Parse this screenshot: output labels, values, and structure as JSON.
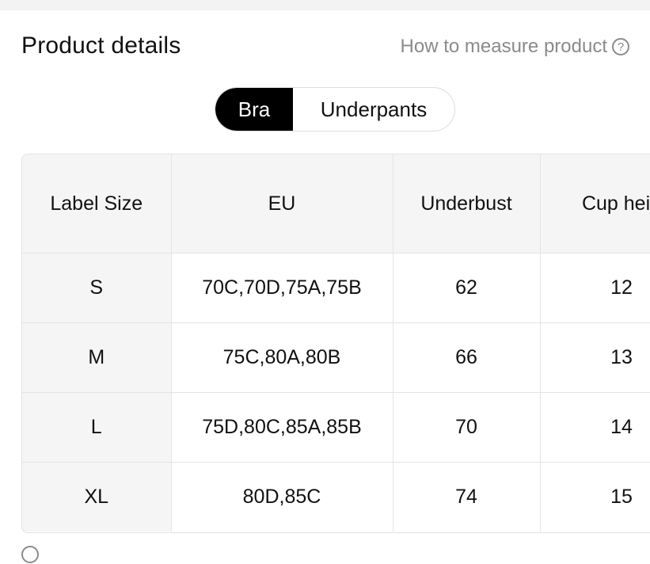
{
  "header": {
    "title": "Product details",
    "how_to_measure": "How to measure product",
    "help_icon": "question-circle-icon",
    "help_glyph": "?"
  },
  "tabs": [
    {
      "label": "Bra",
      "active": true
    },
    {
      "label": "Underpants",
      "active": false
    }
  ],
  "table": {
    "columns": [
      "Label Size",
      "EU",
      "Underbust",
      "Cup heig"
    ],
    "rows": [
      {
        "size": "S",
        "eu": "70C,70D,75A,75B",
        "underbust": "62",
        "cup_height": "12"
      },
      {
        "size": "M",
        "eu": "75C,80A,80B",
        "underbust": "66",
        "cup_height": "13"
      },
      {
        "size": "L",
        "eu": "75D,80C,85A,85B",
        "underbust": "70",
        "cup_height": "14"
      },
      {
        "size": "XL",
        "eu": "80D,85C",
        "underbust": "74",
        "cup_height": "15"
      }
    ]
  },
  "footer_note": {
    "icon": "info-circle-icon"
  },
  "colors": {
    "active_tab_bg": "#000000",
    "header_bg": "#f5f5f5",
    "muted_text": "#8a8a8a"
  }
}
